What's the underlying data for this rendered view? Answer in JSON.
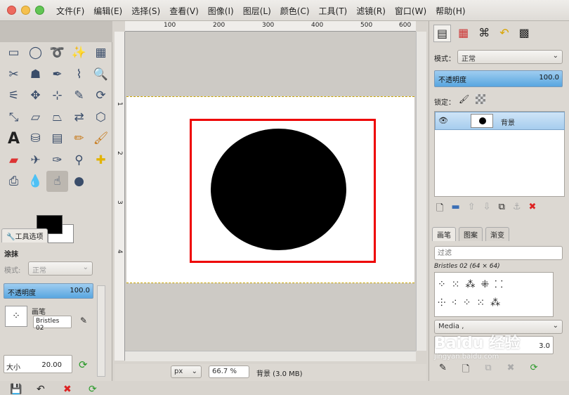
{
  "menubar": {
    "items": [
      "文件(F)",
      "编辑(E)",
      "选择(S)",
      "查看(V)",
      "图像(I)",
      "图层(L)",
      "颜色(C)",
      "工具(T)",
      "滤镜(R)",
      "窗口(W)",
      "帮助(H)"
    ]
  },
  "toolbox": {
    "tools": [
      "rect-select",
      "ellipse-select",
      "free-select",
      "fuzzy-select",
      "select-by-color",
      "scissors",
      "foreground-select",
      "paths",
      "color-picker",
      "zoom",
      "measure",
      "move",
      "align",
      "crop",
      "rotate",
      "scale",
      "shear",
      "perspective",
      "flip",
      "cage",
      "text",
      "bucket-fill",
      "blend",
      "pencil",
      "paintbrush",
      "eraser",
      "airbrush",
      "ink",
      "clone",
      "heal",
      "perspective-clone",
      "blur",
      "smudge",
      "dodge-burn"
    ],
    "tool_options_tab": "工具选项",
    "smudge_title": "涂抹",
    "mode_label": "模式:",
    "mode_value": "正常",
    "opacity_label": "不透明度",
    "opacity_value": "100.0",
    "brush_label": "画笔",
    "brush_value": "Bristles 02",
    "size_label": "大小",
    "size_value": "20.00"
  },
  "canvas": {
    "ruler_marks": [
      "100",
      "200",
      "300",
      "400",
      "500",
      "600"
    ],
    "ruler_v_marks": [
      "1",
      "2",
      "3",
      "4"
    ],
    "unit": "px",
    "zoom": "66.7 %",
    "status": "背景 (3.0 MB)"
  },
  "layers": {
    "mode_label": "模式：",
    "mode_value": "正常",
    "opacity_label": "不透明度",
    "opacity_value": "100.0",
    "lock_label": "锁定：",
    "layer_name": "背景"
  },
  "brushes": {
    "tabs": [
      "画笔",
      "图案",
      "渐变"
    ],
    "filter_placeholder": "过滤",
    "brush_info": "Bristles 02 (64 × 64)",
    "category": "Media ,",
    "spacing_value": "3.0"
  },
  "watermark": "Baidu 经验",
  "watermark_url": "jingyan.baidu.com",
  "colors": {
    "accent": "#58a6e0",
    "red_frame": "#e00000"
  }
}
